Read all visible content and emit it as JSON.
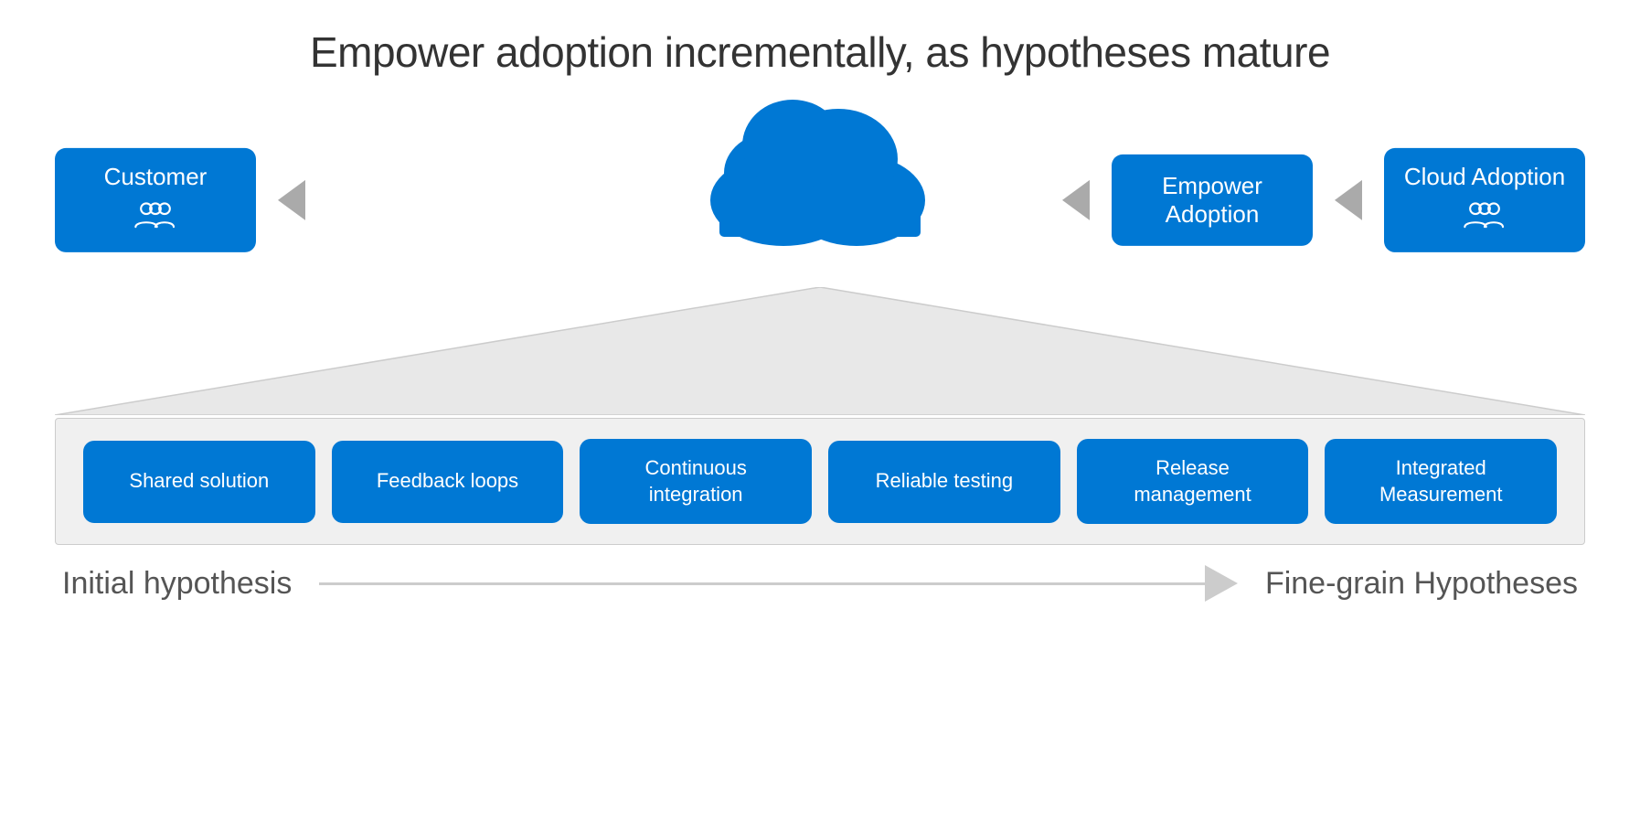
{
  "page": {
    "title": "Empower adoption incrementally, as hypotheses mature"
  },
  "top_boxes": {
    "customer": {
      "label": "Customer",
      "icon": "👥"
    },
    "empower": {
      "label": "Empower\nAdoption",
      "icon": ""
    },
    "cloud": {
      "label": "Cloud Adoption",
      "icon": "👥"
    }
  },
  "bottom_boxes": [
    {
      "label": "Shared solution"
    },
    {
      "label": "Feedback loops"
    },
    {
      "label": "Continuous integration"
    },
    {
      "label": "Reliable testing"
    },
    {
      "label": "Release management"
    },
    {
      "label": "Integrated Measurement"
    }
  ],
  "axis": {
    "left": "Initial hypothesis",
    "right": "Fine-grain Hypotheses"
  }
}
